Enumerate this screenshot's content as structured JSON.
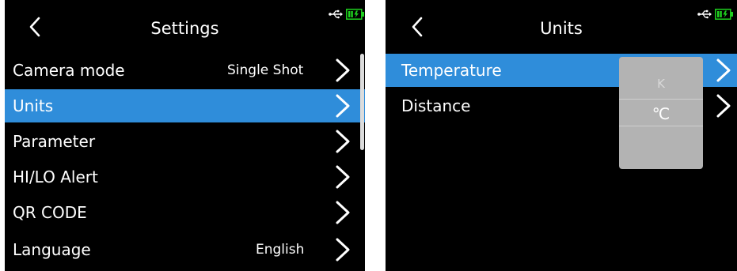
{
  "settings_screen": {
    "title": "Settings",
    "items": [
      {
        "label": "Camera mode",
        "value": "Single Shot"
      },
      {
        "label": "Units",
        "value": ""
      },
      {
        "label": "Parameter",
        "value": ""
      },
      {
        "label": "HI/LO Alert",
        "value": ""
      },
      {
        "label": "QR CODE",
        "value": ""
      },
      {
        "label": "Language",
        "value": "English"
      }
    ],
    "selected_item": "Units"
  },
  "units_screen": {
    "title": "Units",
    "items": [
      {
        "label": "Temperature"
      },
      {
        "label": "Distance"
      }
    ],
    "selected_item": "Temperature",
    "picker": {
      "options": [
        "K",
        "℃"
      ],
      "selected": "℃"
    }
  },
  "status_icons": [
    "usb-icon",
    "battery-charging-icon"
  ],
  "colors": {
    "background": "#000000",
    "selection": "#2f8dda",
    "text": "#ffffff",
    "picker_bg": "#b3b3b3",
    "battery": "#1fd21f"
  }
}
